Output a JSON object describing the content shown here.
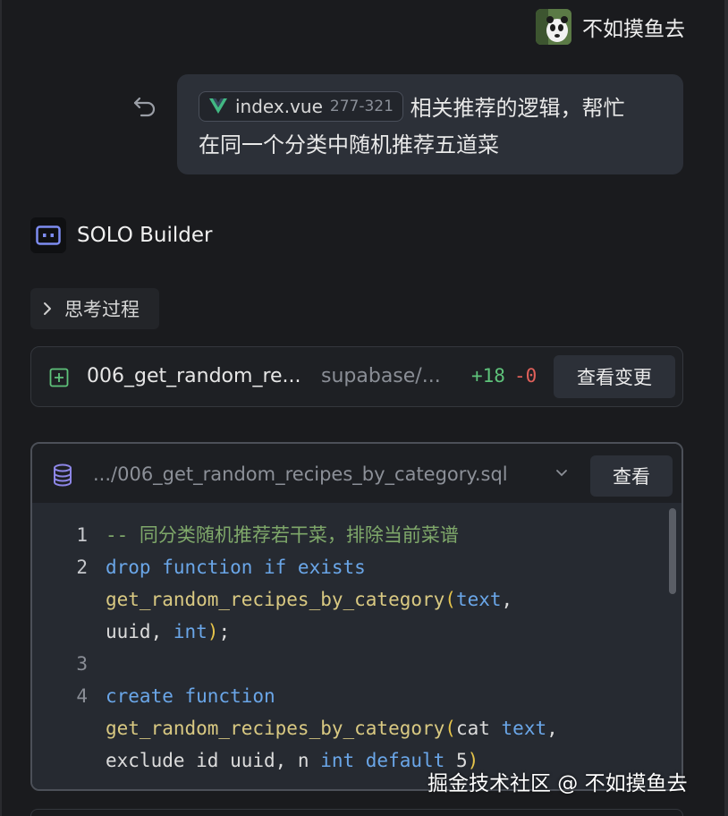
{
  "user": {
    "name": "不如摸鱼去"
  },
  "message": {
    "file_chip": {
      "name": "index.vue",
      "range": "277-321"
    },
    "text_line1": "相关推荐的逻辑，帮忙",
    "text_line2": "在同一个分类中随机推荐五道菜"
  },
  "builder": {
    "name": "SOLO Builder"
  },
  "thinking": {
    "label": "思考过程"
  },
  "file_change": {
    "name": "006_get_random_re...",
    "path": "supabase/...",
    "additions": "+18",
    "deletions": "-0",
    "button": "查看变更"
  },
  "code_panel": {
    "path": ".../006_get_random_recipes_by_category.sql",
    "button": "查看",
    "lines": [
      {
        "num": "1",
        "parts": [
          {
            "t": "-- 同分类随机推荐若干菜，排除当前菜谱",
            "c": "comment"
          }
        ]
      },
      {
        "num": "2",
        "parts": [
          {
            "t": "drop function if exists",
            "c": "kw"
          }
        ]
      },
      {
        "num": "",
        "parts": [
          {
            "t": "get_random_recipes_by_category",
            "c": "fn"
          },
          {
            "t": "(",
            "c": "paren"
          },
          {
            "t": "text",
            "c": "type"
          },
          {
            "t": ",",
            "c": "plain"
          }
        ]
      },
      {
        "num": "",
        "parts": [
          {
            "t": "uuid, ",
            "c": "plain"
          },
          {
            "t": "int",
            "c": "type"
          },
          {
            "t": ")",
            "c": "paren"
          },
          {
            "t": ";",
            "c": "plain"
          }
        ]
      },
      {
        "num": "3",
        "parts": []
      },
      {
        "num": "4",
        "parts": [
          {
            "t": "create function",
            "c": "kw"
          }
        ]
      },
      {
        "num": "",
        "parts": [
          {
            "t": "get_random_recipes_by_category",
            "c": "fn"
          },
          {
            "t": "(",
            "c": "paren"
          },
          {
            "t": "cat ",
            "c": "plain"
          },
          {
            "t": "text",
            "c": "type"
          },
          {
            "t": ",",
            "c": "plain"
          }
        ]
      },
      {
        "num": "",
        "parts": [
          {
            "t": "exclude id uuid, n ",
            "c": "plain"
          },
          {
            "t": "int default ",
            "c": "type"
          },
          {
            "t": "5",
            "c": "plain"
          },
          {
            "t": ")",
            "c": "paren"
          }
        ]
      }
    ]
  },
  "watermark": "掘金技术社区 @ 不如摸鱼去",
  "colors": {
    "add": "#5ec27a",
    "del": "#e0605a",
    "keyword": "#6aa6e8",
    "comment": "#7fa86a",
    "vue_green": "#42b883"
  }
}
